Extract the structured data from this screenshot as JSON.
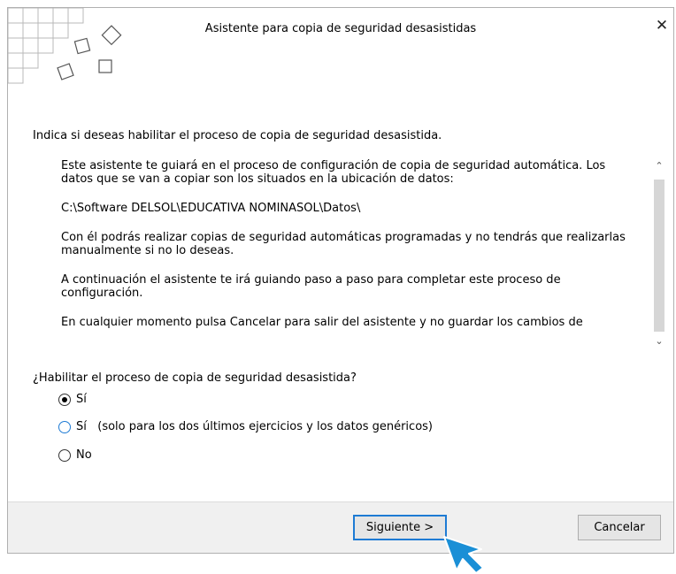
{
  "dialog": {
    "title": "Asistente para copia de seguridad desasistidas",
    "close_label": "✕",
    "intro": "Indica si deseas habilitar el proceso de copia de seguridad desasistida.",
    "info_paragraphs": [
      "Este asistente te guiará en el proceso de configuración de copia de seguridad automática. Los datos que se van a copiar son los situados en la ubicación de datos:",
      "C:\\Software DELSOL\\EDUCATIVA NOMINASOL\\Datos\\",
      "Con él podrás realizar copias de seguridad automáticas programadas y no tendrás que realizarlas manualmente si no lo deseas.",
      "A continuación el asistente te irá guiando paso a paso para completar este proceso de configuración.",
      "En cualquier momento pulsa Cancelar para salir del asistente y no guardar los cambios de"
    ],
    "question": "¿Habilitar el proceso de copia de seguridad desasistida?",
    "options": [
      {
        "label": "Sí",
        "checked": true
      },
      {
        "label": "Sí   (solo para los dos últimos ejercicios y los datos genéricos)",
        "checked": false
      },
      {
        "label": "No",
        "checked": false
      }
    ],
    "buttons": {
      "next": "Siguiente >",
      "cancel": "Cancelar"
    }
  },
  "colors": {
    "accent": "#1e7bd4",
    "footer_bg": "#f0f0f0",
    "cursor": "#1a8fd6"
  }
}
